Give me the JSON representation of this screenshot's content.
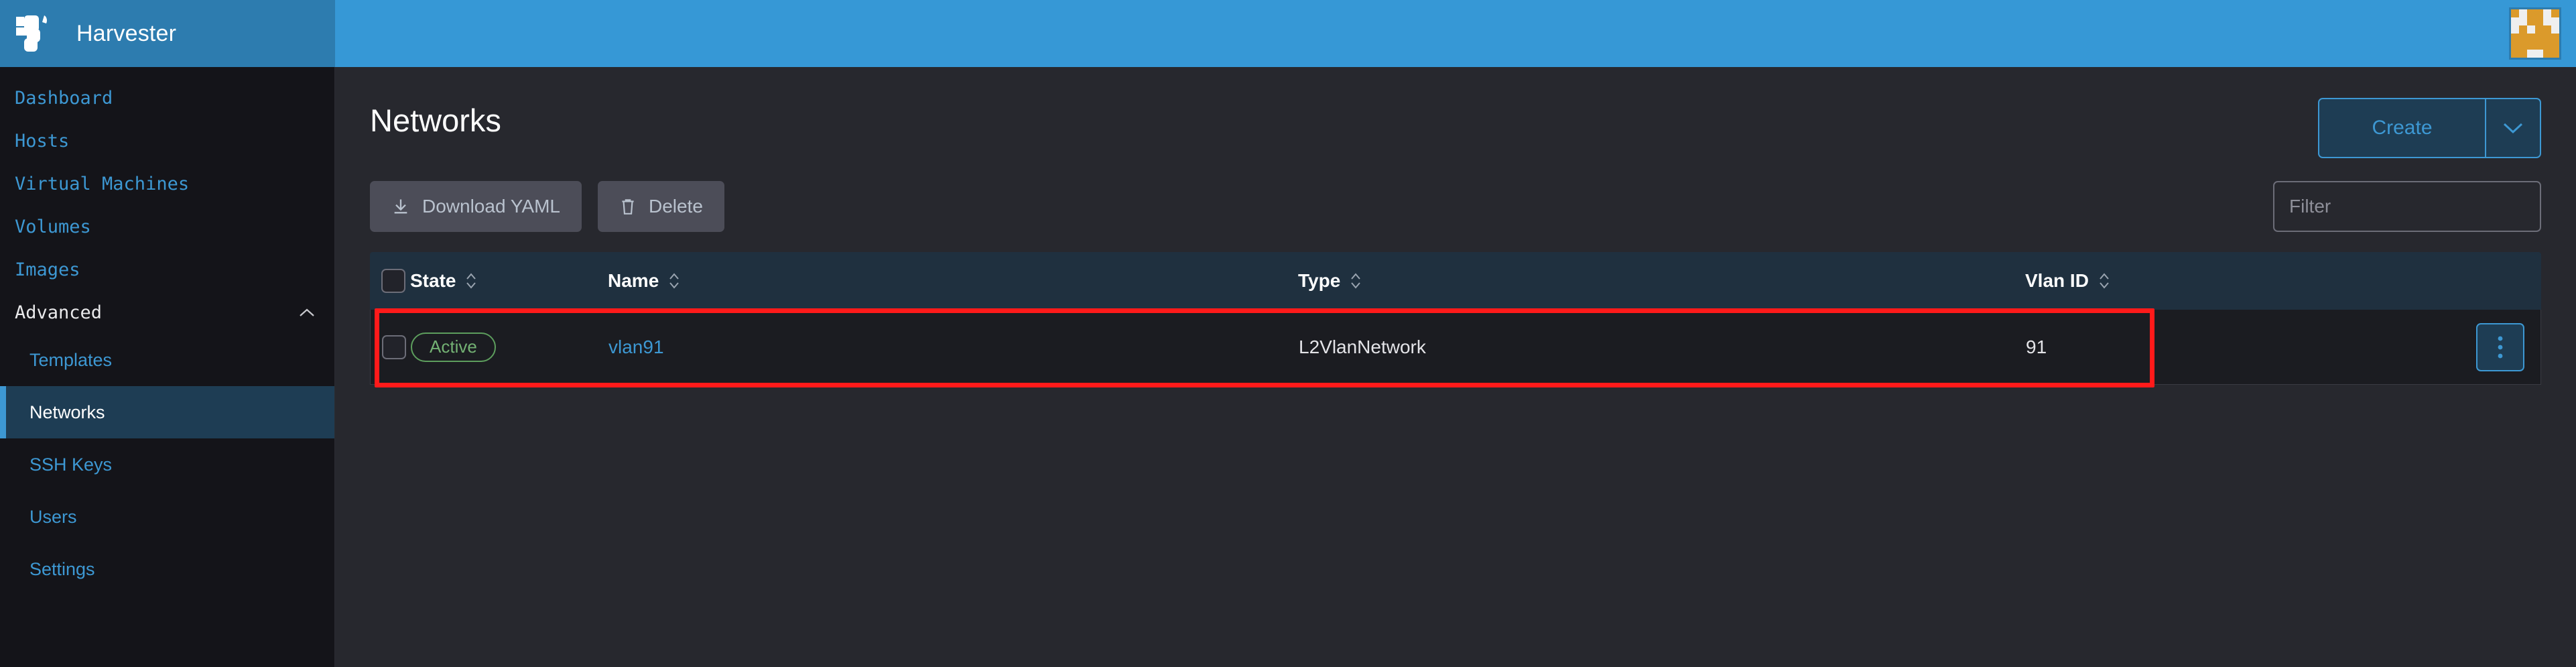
{
  "app": {
    "brand_name": "Harvester",
    "brand_logo_icon": "harvester-logo-icon",
    "avatar_icon": "user-identicon-avatar",
    "colors": {
      "topbar_brand": "#2D7CAF",
      "topbar_rest": "#3698D6",
      "accent_blue": "#3D98D3",
      "active_nav_bg": "#1E3D54",
      "sidebar_bg": "#141419",
      "main_bg": "#27282E",
      "table_header_bg": "#1F303F",
      "row_bg": "#1B1C21",
      "status_active_green": "#73B173",
      "annotation_red": "#FF1A1A",
      "button_gray": "#4C4D58"
    }
  },
  "sidebar": {
    "top_items": [
      {
        "label": "Dashboard"
      },
      {
        "label": "Hosts"
      },
      {
        "label": "Virtual Machines"
      },
      {
        "label": "Volumes"
      },
      {
        "label": "Images"
      }
    ],
    "group": {
      "label": "Advanced",
      "collapse_icon": "chevron-up-icon",
      "expanded": true
    },
    "sub_items": [
      {
        "label": "Templates",
        "active": false
      },
      {
        "label": "Networks",
        "active": true
      },
      {
        "label": "SSH Keys",
        "active": false
      },
      {
        "label": "Users",
        "active": false
      },
      {
        "label": "Settings",
        "active": false
      }
    ]
  },
  "header": {
    "title": "Networks",
    "create_label": "Create",
    "create_caret_icon": "chevron-down-icon"
  },
  "toolbar": {
    "download_yaml_label": "Download YAML",
    "download_yaml_icon": "download-icon",
    "delete_label": "Delete",
    "delete_icon": "trash-icon",
    "filter_placeholder": "Filter",
    "filter_value": ""
  },
  "table": {
    "select_all_icon": "checkbox-icon",
    "sort_icon": "sort-arrows-icon",
    "columns": [
      {
        "key": "state",
        "label": "State",
        "sortable": true
      },
      {
        "key": "name",
        "label": "Name",
        "sortable": true
      },
      {
        "key": "type",
        "label": "Type",
        "sortable": true
      },
      {
        "key": "vlan_id",
        "label": "Vlan ID",
        "sortable": true
      }
    ],
    "rows": [
      {
        "selected": false,
        "state": "Active",
        "name": "vlan91",
        "type": "L2VlanNetwork",
        "vlan_id": "91",
        "actions_icon": "kebab-menu-icon",
        "highlighted": true
      }
    ]
  }
}
